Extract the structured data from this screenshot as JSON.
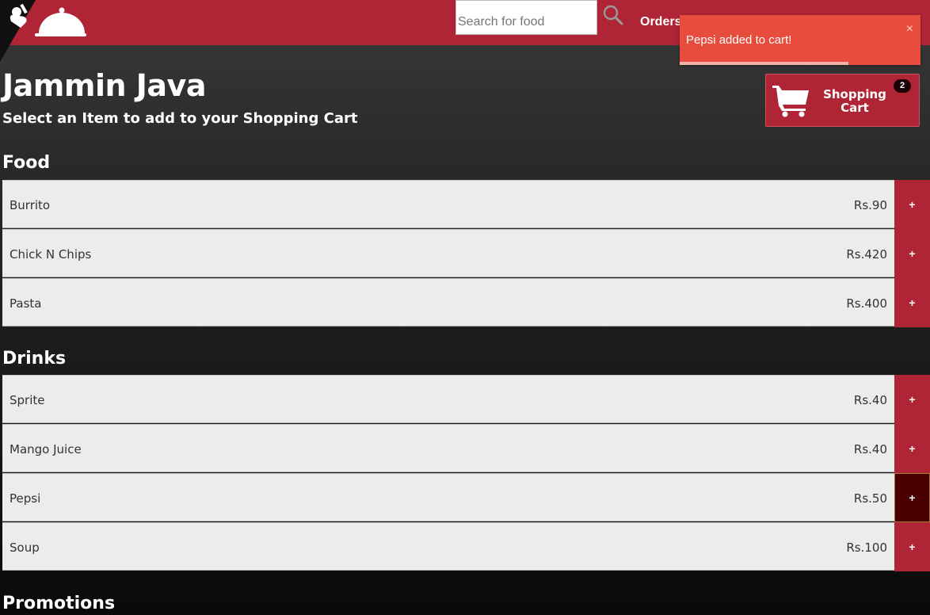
{
  "search": {
    "placeholder": "Search for food"
  },
  "nav": {
    "orders": "Orders"
  },
  "header": {
    "title": "Jammin Java",
    "subtitle": "Select an Item to add to your Shopping Cart"
  },
  "cart": {
    "label": "Shopping Cart",
    "count": "2"
  },
  "toast": {
    "message": "Pepsi added to cart!",
    "close": "×",
    "progress": 0.7
  },
  "sections": [
    {
      "title": "Food",
      "items": [
        {
          "name": "Burrito",
          "price": "Rs.90"
        },
        {
          "name": "Chick N Chips",
          "price": "Rs.420"
        },
        {
          "name": "Pasta",
          "price": "Rs.400"
        }
      ]
    },
    {
      "title": "Drinks",
      "items": [
        {
          "name": "Sprite",
          "price": "Rs.40"
        },
        {
          "name": "Mango Juice",
          "price": "Rs.40"
        },
        {
          "name": "Pepsi",
          "price": "Rs.50"
        },
        {
          "name": "Soup",
          "price": "Rs.100"
        }
      ]
    },
    {
      "title": "Promotions",
      "items": []
    }
  ],
  "add_label": "+",
  "colors": {
    "brand": "#b02535",
    "toast": "#e84c3d",
    "active_add": "#4a0000"
  },
  "icons": {
    "logo": "waiter-cloche-icon",
    "search": "search-icon",
    "cart": "shopping-cart-icon"
  }
}
